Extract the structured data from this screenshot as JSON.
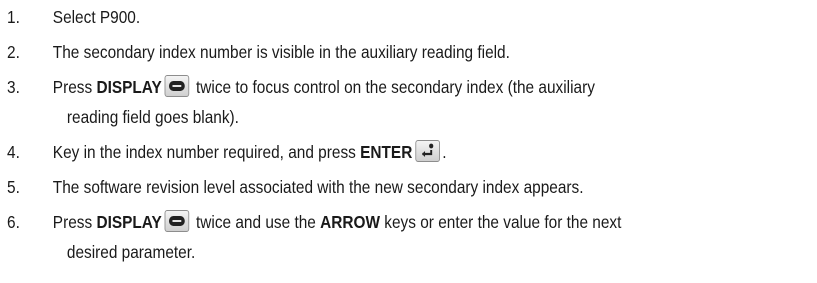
{
  "steps": [
    {
      "num": "1.",
      "text": "Select P900."
    },
    {
      "num": "2.",
      "text": "The secondary index number is visible in the auxiliary reading field."
    },
    {
      "num": "3.",
      "pre": "Press ",
      "key": "DISPLAY",
      "post": " twice to focus control on the secondary index (the auxiliary",
      "cont": "reading field goes blank)."
    },
    {
      "num": "4.",
      "pre": "Key in the index number required, and press ",
      "key": "ENTER",
      "post": "."
    },
    {
      "num": "5.",
      "text": "The software revision level associated with the new secondary index appears."
    },
    {
      "num": "6.",
      "pre": "Press ",
      "key": "DISPLAY",
      "post": " twice and use the ",
      "key2": "ARROW",
      "post2": " keys or enter the value for the next",
      "cont": "desired parameter."
    }
  ],
  "icons": {
    "display_key": "display-key-icon",
    "enter_key": "enter-key-icon"
  },
  "colors": {
    "text": "#1a1a1a",
    "key_face": "#e4e4e4",
    "key_border": "#8d8d8d"
  }
}
